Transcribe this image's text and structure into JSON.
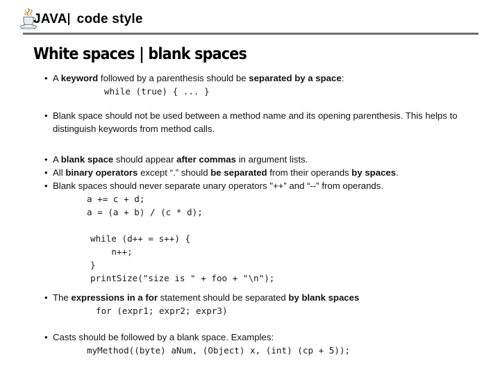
{
  "header": {
    "logo_icon": "java-coffee-cup-logo",
    "brand": "JAVA",
    "subtitle": "code style"
  },
  "slide": {
    "title": "White spaces | blank spaces",
    "blocks": [
      {
        "id": "keyword-parenthesis",
        "bullet_marker": "•",
        "text_runs": [
          {
            "t": "A ",
            "b": false
          },
          {
            "t": "keyword",
            "b": true
          },
          {
            "t": " followed by a parenthesis should be ",
            "b": false
          },
          {
            "t": "separated by a space",
            "b": true
          },
          {
            "t": ":",
            "b": false
          }
        ],
        "code": [
          "while (true) { ... }"
        ]
      },
      {
        "id": "method-name-parenthesis",
        "bullet_marker": "•",
        "text_runs": [
          {
            "t": "Blank space should not be used between a method name and its opening parenthesis. This helps to distinguish keywords from method calls.",
            "b": false
          }
        ],
        "code": []
      },
      {
        "id": "after-commas",
        "bullet_marker": "•",
        "text_runs": [
          {
            "t": "A ",
            "b": false
          },
          {
            "t": "blank space",
            "b": true
          },
          {
            "t": " should appear ",
            "b": false
          },
          {
            "t": "after commas",
            "b": true
          },
          {
            "t": " in argument lists.",
            "b": false
          }
        ],
        "code": []
      },
      {
        "id": "binary-operators",
        "bullet_marker": "•",
        "text_runs": [
          {
            "t": "All ",
            "b": false
          },
          {
            "t": "binary operators",
            "b": true
          },
          {
            "t": " except “.” should ",
            "b": false
          },
          {
            "t": "be separated",
            "b": true
          },
          {
            "t": " from their operands  ",
            "b": false
          },
          {
            "t": "by spaces",
            "b": true
          },
          {
            "t": ".",
            "b": false
          }
        ],
        "code": []
      },
      {
        "id": "unary-operators",
        "bullet_marker": "•",
        "text_runs": [
          {
            "t": "Blank spaces should never separate unary operators \"++” and “--” from operands.",
            "b": false
          }
        ],
        "code": [
          "a += c + d;",
          "a = (a + b) / (c * d);"
        ]
      },
      {
        "id": "while-example",
        "bullet_marker": "",
        "text_runs": [],
        "code": [
          "while (d++ = s++) {",
          "    n++;",
          "}",
          "printSize(\"size is \" + foo + \"\\n\");"
        ]
      },
      {
        "id": "for-statement",
        "bullet_marker": "•",
        "text_runs": [
          {
            "t": "The ",
            "b": false
          },
          {
            "t": "expressions in a for",
            "b": true
          },
          {
            "t": " statement should be separated ",
            "b": false
          },
          {
            "t": "by blank spaces",
            "b": true
          }
        ],
        "code": [
          "for (expr1; expr2; expr3)"
        ]
      },
      {
        "id": "casts",
        "bullet_marker": "•",
        "text_runs": [
          {
            "t": "Casts should be followed by a blank space. Examples:",
            "b": false
          }
        ],
        "code": [
          "myMethod((byte) aNum, (Object) x, (int) (cp + 5));"
        ]
      }
    ]
  },
  "colors": {
    "rule": "#6e6e71",
    "text": "#111111",
    "code": "#1a1a1a",
    "logo_steam": "#b4813c",
    "logo_cup": "#dfe7ee"
  }
}
